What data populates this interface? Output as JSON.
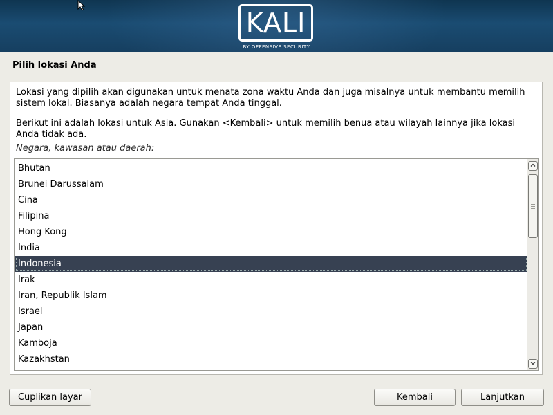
{
  "banner": {
    "logo_text": "KALI",
    "logo_subtitle": "BY OFFENSIVE SECURITY",
    "colors": {
      "banner_dark": "#0f3550",
      "banner_mid": "#1a4c72",
      "selection": "#374152"
    }
  },
  "page": {
    "title": "Pilih lokasi Anda"
  },
  "content": {
    "paragraph1": "Lokasi yang dipilih akan digunakan untuk menata zona waktu Anda dan juga misalnya untuk membantu memilih sistem lokal. Biasanya adalah negara tempat Anda tinggal.",
    "paragraph2": "Berikut ini adalah lokasi untuk Asia. Gunakan <Kembali> untuk memilih benua atau wilayah lainnya jika lokasi Anda tidak ada.",
    "list_label": "Negara, kawasan atau daerah:"
  },
  "list": {
    "items": [
      "Bhutan",
      "Brunei Darussalam",
      "Cina",
      "Filipina",
      "Hong Kong",
      "India",
      "Indonesia",
      "Irak",
      "Iran, Republik Islam",
      "Israel",
      "Japan",
      "Kamboja",
      "Kazakhstan"
    ],
    "selected": "Indonesia"
  },
  "buttons": {
    "screenshot": "Cuplikan layar",
    "back": "Kembali",
    "continue": "Lanjutkan"
  }
}
